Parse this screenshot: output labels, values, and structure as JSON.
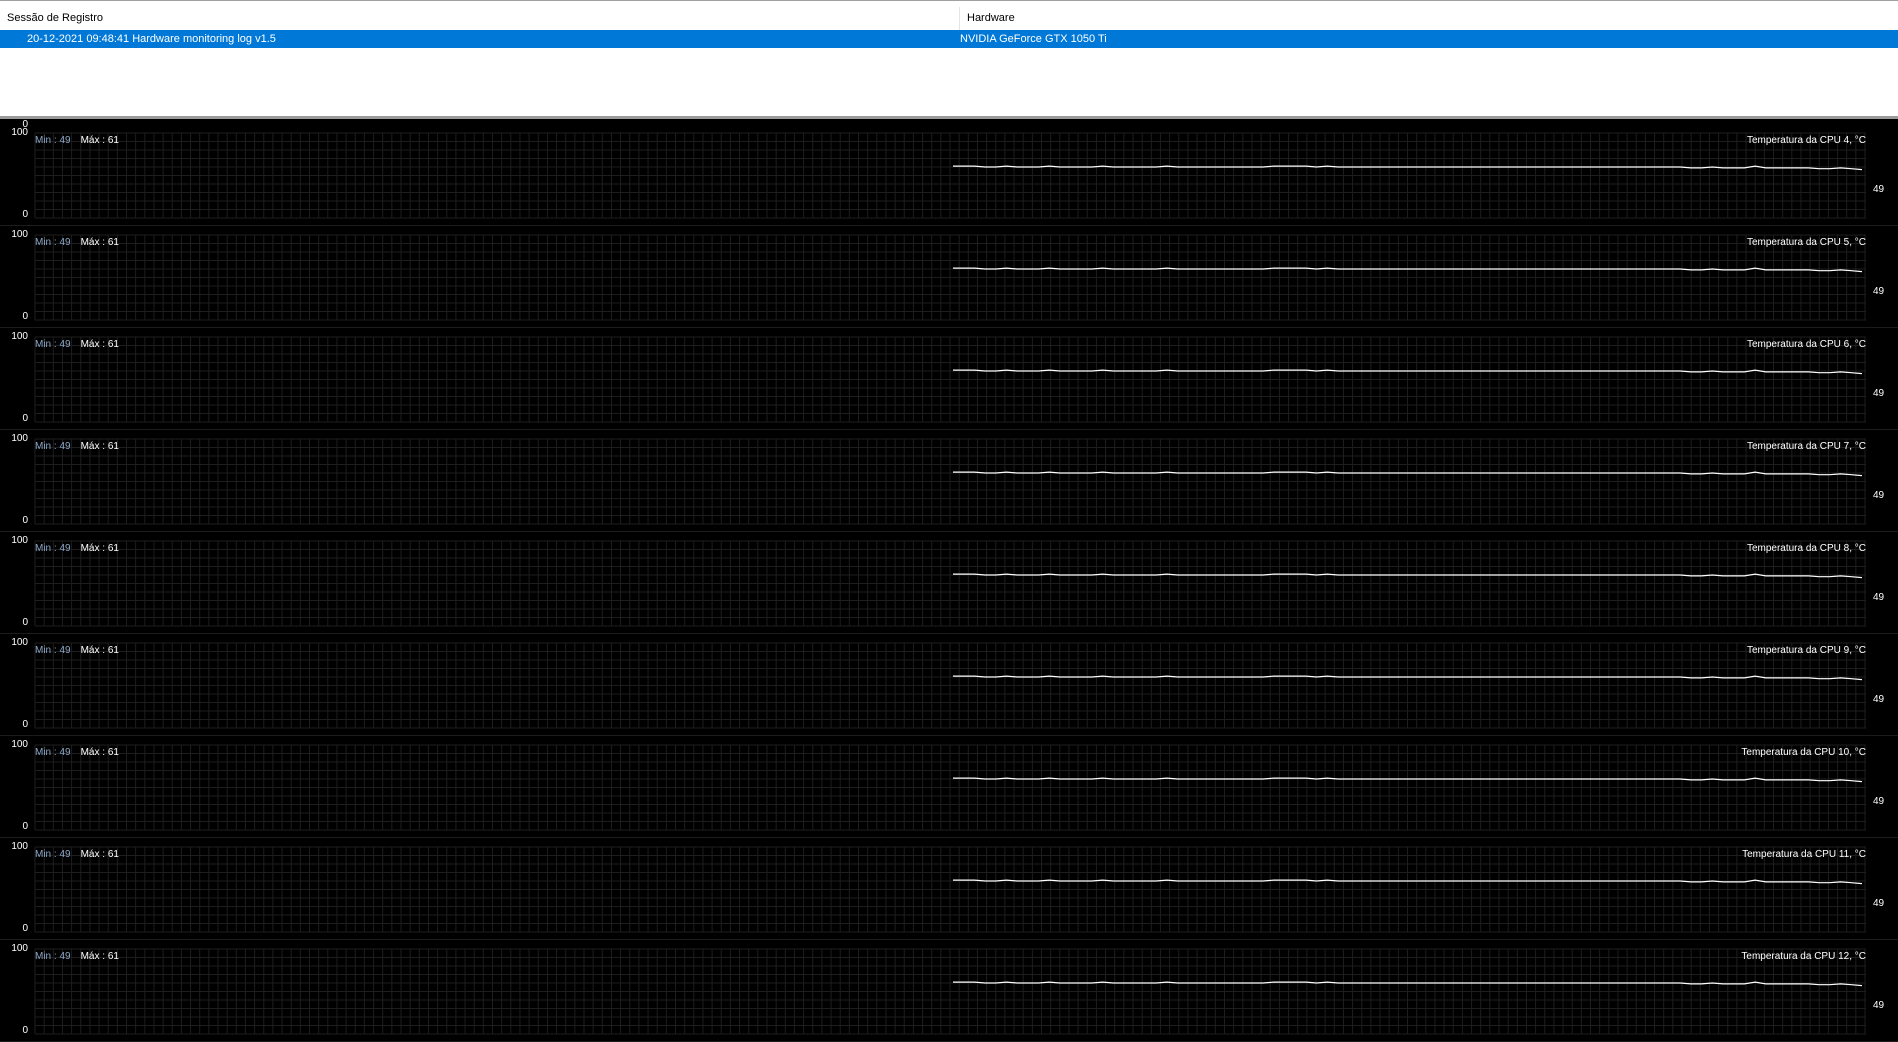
{
  "log": {
    "columns": [
      "Sessão de Registro",
      "Hardware"
    ],
    "rows": [
      {
        "session": "20-12-2021 09:48:41 Hardware monitoring log v1.5",
        "hardware": "NVIDIA GeForce GTX 1050 Ti"
      }
    ]
  },
  "graphs": {
    "top_zero": "0",
    "axis_max": "100",
    "axis_min": "0",
    "min_label": "Min : ",
    "max_label": "Máx : ",
    "colors": {
      "background": "#000000",
      "grid": "#1e1e1e",
      "line": "#ffffff",
      "min_text": "#8aa7c8"
    },
    "items": [
      {
        "title": "Temperatura da CPU 4, °C",
        "min": "49",
        "max": "61",
        "current": "49"
      },
      {
        "title": "Temperatura da CPU 5, °C",
        "min": "49",
        "max": "61",
        "current": "49"
      },
      {
        "title": "Temperatura da CPU 6, °C",
        "min": "49",
        "max": "61",
        "current": "49"
      },
      {
        "title": "Temperatura da CPU 7, °C",
        "min": "49",
        "max": "61",
        "current": "49"
      },
      {
        "title": "Temperatura da CPU 8, °C",
        "min": "49",
        "max": "61",
        "current": "49"
      },
      {
        "title": "Temperatura da CPU 9, °C",
        "min": "49",
        "max": "61",
        "current": "49"
      },
      {
        "title": "Temperatura da CPU 10, °C",
        "min": "49",
        "max": "61",
        "current": "49"
      },
      {
        "title": "Temperatura da CPU 11, °C",
        "min": "49",
        "max": "61",
        "current": "49"
      },
      {
        "title": "Temperatura da CPU 12, °C",
        "min": "49",
        "max": "61",
        "current": "49"
      }
    ],
    "series": [
      61,
      61,
      61,
      60,
      60,
      61,
      60,
      60,
      60,
      61,
      60,
      60,
      60,
      60,
      61,
      60,
      60,
      60,
      60,
      60,
      61,
      60,
      60,
      60,
      60,
      60,
      60,
      60,
      60,
      60,
      61,
      61,
      61,
      61,
      60,
      61,
      60,
      60,
      60,
      60,
      60,
      60,
      60,
      60,
      60,
      60,
      60,
      60,
      60,
      60,
      60,
      60,
      60,
      60,
      60,
      60,
      60,
      60,
      60,
      60,
      60,
      60,
      60,
      60,
      60,
      60,
      60,
      60,
      60,
      59,
      59,
      60,
      59,
      59,
      59,
      61,
      59,
      59,
      59,
      59,
      59,
      58,
      58,
      59,
      58,
      57
    ]
  }
}
